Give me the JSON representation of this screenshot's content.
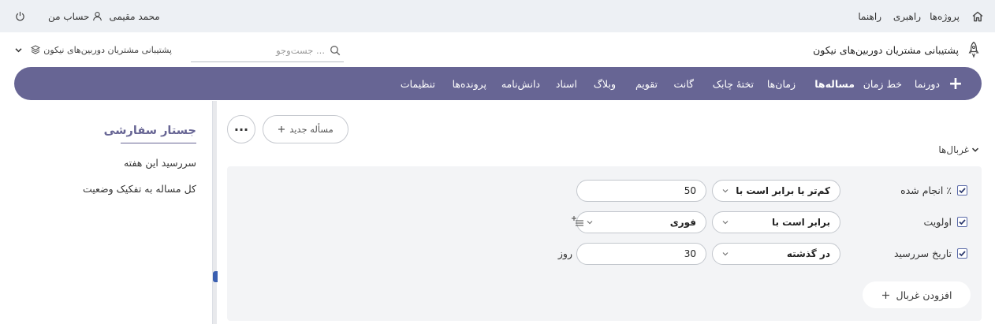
{
  "topbar": {
    "home_icon": "home-icon",
    "nav": [
      {
        "label": "پروژه‌ها"
      },
      {
        "label": "راهبری"
      },
      {
        "label": "راهنما"
      }
    ],
    "user_name": "محمد مقیمی",
    "account_label": "حساب من",
    "user_icon": "user-icon",
    "power_icon": "power-icon"
  },
  "project": {
    "title": "پشتیبانی مشتریان دوربین‌های نیکون",
    "icon": "rocket-icon",
    "switcher_label": "پشتیبانی مشتریان دوربین‌های نیکون",
    "switcher_icon": "layers-icon"
  },
  "search": {
    "placeholder": "... جست‌وجو",
    "value": ""
  },
  "mainnav": {
    "add_label": "+",
    "items": [
      {
        "label": "دورنما"
      },
      {
        "label": "خط زمان"
      },
      {
        "label": "مساله‌ها"
      },
      {
        "label": "زمان‌ها"
      },
      {
        "label": "تختهٔ چابک"
      },
      {
        "label": "گانت"
      },
      {
        "label": "تقویم"
      },
      {
        "label": "وبلاگ"
      },
      {
        "label": "اسناد"
      },
      {
        "label": "دانش‌نامه"
      },
      {
        "label": "پرونده‌ها"
      },
      {
        "label": "تنظیمات"
      }
    ],
    "active": "مساله‌ها",
    "color": "#676594"
  },
  "sidebar": {
    "title": "جستار سفارشی",
    "queries": [
      {
        "label": "سررسید این هفته"
      },
      {
        "label": "کل مساله به تفکیک وضعیت"
      }
    ]
  },
  "toolbar": {
    "new_issue_label": "مسأله جدید",
    "more_label": "···"
  },
  "filters": {
    "toggle_label": "غربال‌ها",
    "rows": [
      {
        "label": "٪ انجام شده",
        "checked": true,
        "operator": "کم‌تر یا برابر است با",
        "value": "50",
        "unit": ""
      },
      {
        "label": "اولویت",
        "checked": true,
        "operator": "برابر است با",
        "value": "فوری",
        "unit": ""
      },
      {
        "label": "تاریخ سررسید",
        "checked": true,
        "operator": "در گذشته",
        "value": "30",
        "unit": "روز"
      }
    ],
    "add_filter_label": "افزودن غربال"
  }
}
